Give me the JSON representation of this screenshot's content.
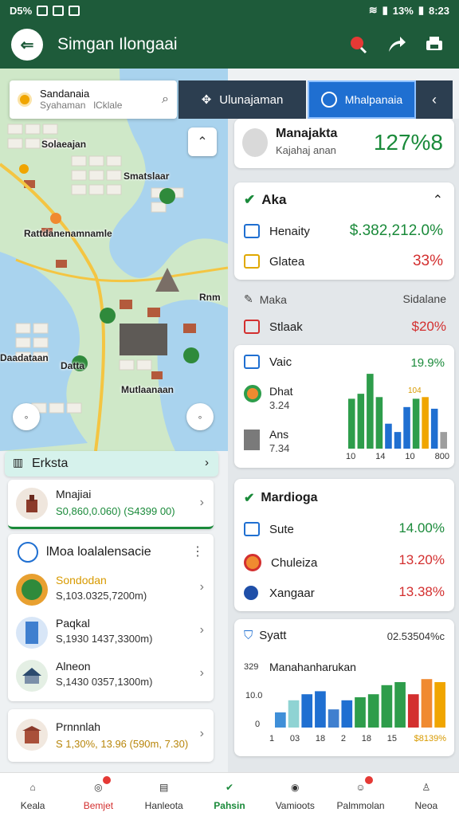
{
  "status": {
    "left_text": "D5%",
    "battery": "13%",
    "time": "8:23"
  },
  "app": {
    "title": "Simgan Ilongaai"
  },
  "search": {
    "value": "Sandanaia",
    "placeholder_a": "Syahaman",
    "placeholder_b": "lCklale"
  },
  "tabs": [
    {
      "label": "Ulunajaman"
    },
    {
      "label": "Mhalpanaia"
    }
  ],
  "map": {
    "labels": [
      "Solaeajan",
      "Smatslaar",
      "Rattdanenamnamle",
      "Daadataan",
      "Mutlaanaan",
      "Datta",
      "Rnm"
    ]
  },
  "summary": {
    "title": "Manajakta",
    "subtitle": "Kajahaj anan",
    "value": "127%8"
  },
  "aka": {
    "title": "Aka",
    "rows": [
      {
        "label": "Henaity",
        "value": "$.382,212.0%"
      },
      {
        "label": "Glatea",
        "value": "33%"
      }
    ]
  },
  "section": {
    "left": "Maka",
    "right": "Sidalane"
  },
  "stiaak": {
    "label": "Stlaak",
    "value": "$20%"
  },
  "chart1": {
    "rows": [
      {
        "label": "Vaic",
        "value": ""
      },
      {
        "label": "Dhat",
        "value": "3.24"
      },
      {
        "label": "Ans",
        "value": "7.34"
      }
    ],
    "top_value": "19.9%",
    "tick_x": [
      "10",
      "14",
      "10",
      "800"
    ],
    "note": "104"
  },
  "chart1_data": {
    "type": "bar",
    "categories": [
      "10",
      "14",
      "10",
      "800"
    ],
    "series": [
      {
        "values": [
          60,
          66,
          90,
          62,
          30,
          20,
          50,
          60,
          62,
          48,
          20
        ]
      }
    ]
  },
  "mardioga": {
    "title": "Mardioga",
    "rows": [
      {
        "label": "Sute",
        "value": "14.00%"
      },
      {
        "label": "Chuleiza",
        "value": "13.20%"
      },
      {
        "label": "Xangaar",
        "value": "13.38%"
      }
    ]
  },
  "chart2": {
    "title": "Syatt",
    "right": "02.53504%c",
    "subtitle": "Manahanharukan",
    "y_ticks": [
      "329",
      "10.0",
      "0"
    ],
    "x_ticks": [
      "1",
      "03",
      "18",
      "2",
      "18",
      "15"
    ],
    "corner": "$8139%"
  },
  "chart_data": {
    "type": "bar",
    "y_ticks": [
      "329",
      "10.0",
      "0"
    ],
    "x_ticks": [
      "1",
      "03",
      "18",
      "2",
      "18",
      "15"
    ],
    "ylim": [
      0,
      20
    ],
    "series": [
      {
        "values": [
          5,
          9,
          11,
          12,
          6,
          9,
          10,
          11,
          14,
          15,
          11,
          16,
          15
        ]
      }
    ]
  },
  "erksta": {
    "title": "Erksta"
  },
  "first_item": {
    "title": "Mnajiai",
    "detail": "S0,860,0.060)  (S4399 00)"
  },
  "list": {
    "title": "lMoa loalalensacie",
    "items": [
      {
        "title": "Sondodan",
        "detail": "S,103.0325,7200m)"
      },
      {
        "title": "Paqkal",
        "detail": "S,1930 1437,3300m)"
      },
      {
        "title": "Alneon",
        "detail": "S,1430 0357,1300m)"
      }
    ]
  },
  "last_item": {
    "title": "Prnnnlah",
    "detail": "S 1,30%, 13.96 (590m, 7.30)"
  },
  "nav": [
    {
      "label": "Keala"
    },
    {
      "label": "Bemjet"
    },
    {
      "label": "Hanleota"
    },
    {
      "label": "Pahsin"
    },
    {
      "label": "Vamioots"
    },
    {
      "label": "Palmmolan"
    },
    {
      "label": "Neoa"
    }
  ]
}
